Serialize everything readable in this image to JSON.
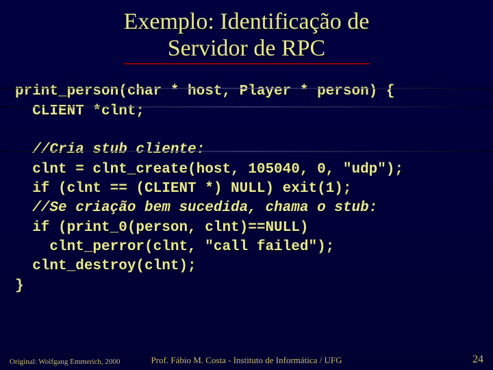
{
  "title": {
    "line1": "Exemplo: Identificação de",
    "line2": "Servidor de RPC"
  },
  "code": {
    "l1": "print_person(char * host, Player * person) {",
    "l2": "  CLIENT *clnt;",
    "l3": "",
    "l4": "  //Cria stub cliente:",
    "l5": "  clnt = clnt_create(host, 105040, 0, \"udp\");",
    "l6": "  if (clnt == (CLIENT *) NULL) exit(1);",
    "l7": "  //Se criação bem sucedida, chama o stub:",
    "l8": "  if (print_0(person, clnt)==NULL)",
    "l9": "    clnt_perror(clnt, \"call failed\");",
    "l10": "  clnt_destroy(clnt);",
    "l11": "}"
  },
  "footer": {
    "left": "Original: Wolfgang Emmerich, 2000",
    "center": "Prof. Fábio M. Costa  -  Instituto de Informática / UFG",
    "page": "24"
  }
}
